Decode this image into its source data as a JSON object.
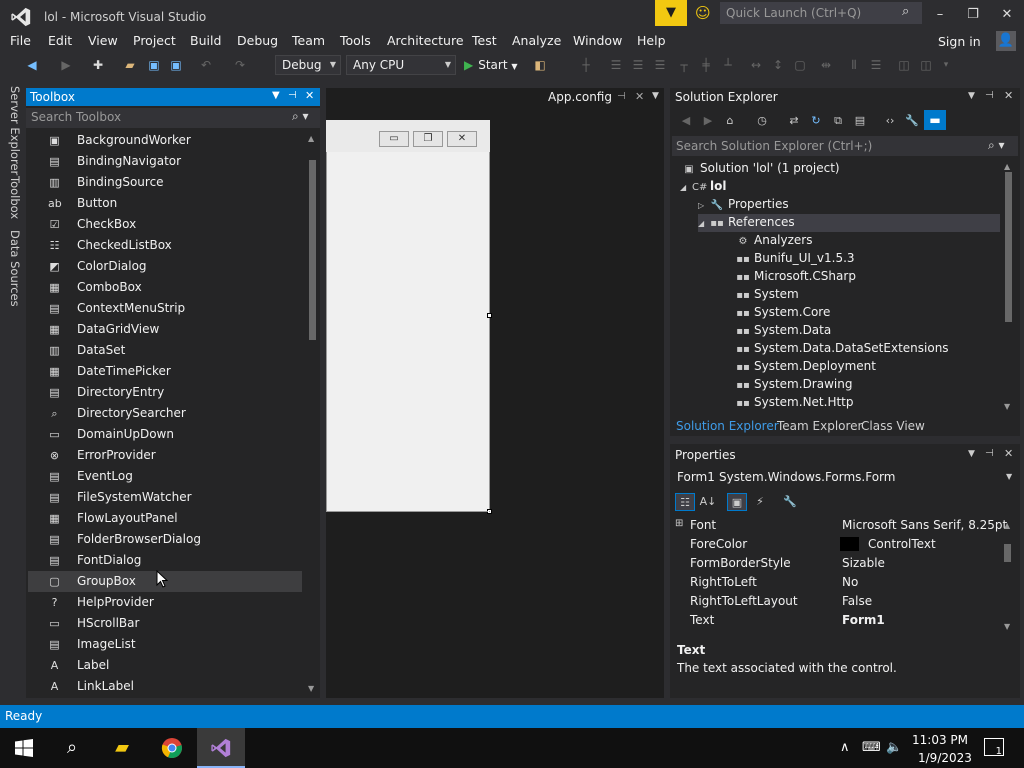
{
  "window": {
    "title": "lol - Microsoft Visual Studio",
    "quick_launch_placeholder": "Quick Launch (Ctrl+Q)",
    "minimize": "–",
    "maximize": "❐",
    "close": "✕"
  },
  "menu": [
    "File",
    "Edit",
    "View",
    "Project",
    "Build",
    "Debug",
    "Team",
    "Tools",
    "Architecture",
    "Test",
    "Analyze",
    "Window",
    "Help"
  ],
  "account": {
    "sign_in": "Sign in"
  },
  "toolbar": {
    "config": "Debug",
    "platform": "Any CPU",
    "start": "Start"
  },
  "side_tabs": [
    "Server Explorer",
    "Toolbox",
    "Data Sources"
  ],
  "toolbox": {
    "title": "Toolbox",
    "search_placeholder": "Search Toolbox",
    "items": [
      {
        "label": "BackgroundWorker",
        "icon": "▣"
      },
      {
        "label": "BindingNavigator",
        "icon": "▤"
      },
      {
        "label": "BindingSource",
        "icon": "▥"
      },
      {
        "label": "Button",
        "icon": "ab"
      },
      {
        "label": "CheckBox",
        "icon": "☑"
      },
      {
        "label": "CheckedListBox",
        "icon": "☷"
      },
      {
        "label": "ColorDialog",
        "icon": "◩"
      },
      {
        "label": "ComboBox",
        "icon": "▦"
      },
      {
        "label": "ContextMenuStrip",
        "icon": "▤"
      },
      {
        "label": "DataGridView",
        "icon": "▦"
      },
      {
        "label": "DataSet",
        "icon": "▥"
      },
      {
        "label": "DateTimePicker",
        "icon": "▦"
      },
      {
        "label": "DirectoryEntry",
        "icon": "▤"
      },
      {
        "label": "DirectorySearcher",
        "icon": "⌕"
      },
      {
        "label": "DomainUpDown",
        "icon": "▭"
      },
      {
        "label": "ErrorProvider",
        "icon": "⊗"
      },
      {
        "label": "EventLog",
        "icon": "▤"
      },
      {
        "label": "FileSystemWatcher",
        "icon": "▤"
      },
      {
        "label": "FlowLayoutPanel",
        "icon": "▦"
      },
      {
        "label": "FolderBrowserDialog",
        "icon": "▤"
      },
      {
        "label": "FontDialog",
        "icon": "▤"
      },
      {
        "label": "GroupBox",
        "icon": "▢"
      },
      {
        "label": "HelpProvider",
        "icon": "?"
      },
      {
        "label": "HScrollBar",
        "icon": "▭"
      },
      {
        "label": "ImageList",
        "icon": "▤"
      },
      {
        "label": "Label",
        "icon": "A"
      },
      {
        "label": "LinkLabel",
        "icon": "A"
      }
    ]
  },
  "designer": {
    "doc_tab": "App.config"
  },
  "solution_explorer": {
    "title": "Solution Explorer",
    "search_placeholder": "Search Solution Explorer (Ctrl+;)",
    "tree": [
      {
        "label": "Solution 'lol' (1 project)",
        "indent": 0,
        "toggle": "",
        "icon": "▣"
      },
      {
        "label": "lol",
        "indent": 1,
        "toggle": "◢",
        "icon": "C#",
        "bold": true
      },
      {
        "label": "Properties",
        "indent": 2,
        "toggle": "▷",
        "icon": "🔧"
      },
      {
        "label": "References",
        "indent": 2,
        "toggle": "◢",
        "icon": "▪▪",
        "selected": true
      },
      {
        "label": "Analyzers",
        "indent": 3,
        "toggle": "",
        "icon": "⚙"
      },
      {
        "label": "Bunifu_UI_v1.5.3",
        "indent": 3,
        "toggle": "",
        "icon": "▪▪"
      },
      {
        "label": "Microsoft.CSharp",
        "indent": 3,
        "toggle": "",
        "icon": "▪▪"
      },
      {
        "label": "System",
        "indent": 3,
        "toggle": "",
        "icon": "▪▪"
      },
      {
        "label": "System.Core",
        "indent": 3,
        "toggle": "",
        "icon": "▪▪"
      },
      {
        "label": "System.Data",
        "indent": 3,
        "toggle": "",
        "icon": "▪▪"
      },
      {
        "label": "System.Data.DataSetExtensions",
        "indent": 3,
        "toggle": "",
        "icon": "▪▪"
      },
      {
        "label": "System.Deployment",
        "indent": 3,
        "toggle": "",
        "icon": "▪▪"
      },
      {
        "label": "System.Drawing",
        "indent": 3,
        "toggle": "",
        "icon": "▪▪"
      },
      {
        "label": "System.Net.Http",
        "indent": 3,
        "toggle": "",
        "icon": "▪▪"
      }
    ],
    "bottom_tabs": [
      "Solution Explorer",
      "Team Explorer",
      "Class View"
    ]
  },
  "properties": {
    "title": "Properties",
    "object_name": "Form1",
    "object_type": "System.Windows.Forms.Form",
    "rows": [
      {
        "name": "Font",
        "value": "Microsoft Sans Serif, 8.25pt",
        "expandable": true
      },
      {
        "name": "ForeColor",
        "value": "ControlText",
        "swatch": true
      },
      {
        "name": "FormBorderStyle",
        "value": "Sizable"
      },
      {
        "name": "RightToLeft",
        "value": "No"
      },
      {
        "name": "RightToLeftLayout",
        "value": "False"
      },
      {
        "name": "Text",
        "value": "Form1",
        "bold": true
      }
    ],
    "desc_title": "Text",
    "desc_text": "The text associated with the control."
  },
  "status": {
    "text": "Ready"
  },
  "taskbar": {
    "time": "11:03 PM",
    "date": "1/9/2023",
    "notification_count": "1"
  },
  "colors": {
    "accent": "#007acc",
    "background": "#2d2d30",
    "panel": "#252526",
    "editor": "#1e1e1e"
  }
}
